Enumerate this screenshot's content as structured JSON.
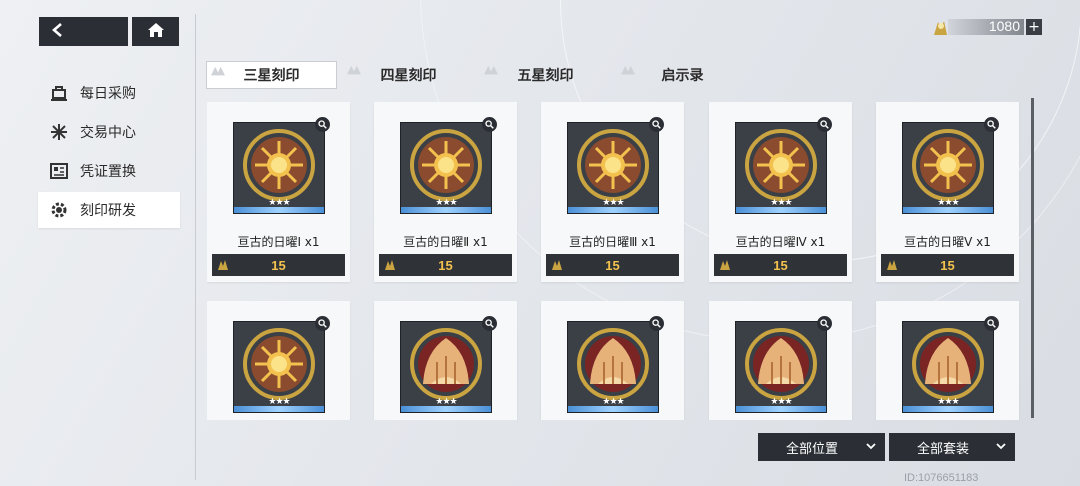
{
  "currency": {
    "amount": "1080",
    "plus": "+",
    "icon": "seal-icon"
  },
  "sidebar": {
    "items": [
      {
        "label": "每日采购",
        "icon": "cart-icon"
      },
      {
        "label": "交易中心",
        "icon": "exchange-icon"
      },
      {
        "label": "凭证置换",
        "icon": "ticket-icon"
      },
      {
        "label": "刻印研发",
        "icon": "gear-icon"
      }
    ],
    "active_index": 3
  },
  "tabs": [
    {
      "label": "三星刻印",
      "active": true
    },
    {
      "label": "四星刻印",
      "active": false
    },
    {
      "label": "五星刻印",
      "active": false
    },
    {
      "label": "启示录",
      "active": false
    }
  ],
  "items": [
    {
      "name": "亘古的日曜Ⅰ x1",
      "price": "15",
      "stars": "★★★",
      "art": "sun"
    },
    {
      "name": "亘古的日曜Ⅱ x1",
      "price": "15",
      "stars": "★★★",
      "art": "sun"
    },
    {
      "name": "亘古的日曜Ⅲ x1",
      "price": "15",
      "stars": "★★★",
      "art": "sun"
    },
    {
      "name": "亘古的日曜Ⅳ x1",
      "price": "15",
      "stars": "★★★",
      "art": "sun"
    },
    {
      "name": "亘古的日曜Ⅴ x1",
      "price": "15",
      "stars": "★★★",
      "art": "sun"
    },
    {
      "name": "",
      "price": "",
      "stars": "★★★",
      "art": "sun"
    },
    {
      "name": "",
      "price": "",
      "stars": "★★★",
      "art": "bell"
    },
    {
      "name": "",
      "price": "",
      "stars": "★★★",
      "art": "bell"
    },
    {
      "name": "",
      "price": "",
      "stars": "★★★",
      "art": "bell"
    },
    {
      "name": "",
      "price": "",
      "stars": "★★★",
      "art": "bell"
    }
  ],
  "filters": {
    "position_label": "全部位置",
    "set_label": "全部套装"
  },
  "uid": "ID:1076651183",
  "colors": {
    "dark_panel": "#2b2f35",
    "price_gold": "#f2c14e",
    "star_strip_blue": "#4a8fd6"
  }
}
